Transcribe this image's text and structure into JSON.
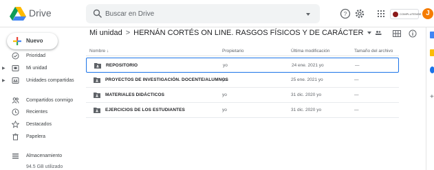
{
  "app": {
    "title": "Drive"
  },
  "search": {
    "placeholder": "Buscar en Drive",
    "value": ""
  },
  "header": {
    "avatar_initial": "J",
    "org_badge_text": "COMPLUTENSE"
  },
  "sidebar": {
    "new_label": "Nuevo",
    "items": [
      {
        "label": "Prioridad",
        "icon": "priority-check-icon",
        "expandable": false
      },
      {
        "label": "Mi unidad",
        "icon": "my-drive-icon",
        "expandable": true
      },
      {
        "label": "Unidades compartidas",
        "icon": "shared-drives-icon",
        "expandable": true
      },
      {
        "label": "Compartidos conmigo",
        "icon": "shared-with-me-icon",
        "expandable": false
      },
      {
        "label": "Recientes",
        "icon": "clock-icon",
        "expandable": false
      },
      {
        "label": "Destacados",
        "icon": "star-icon",
        "expandable": false
      },
      {
        "label": "Papelera",
        "icon": "trash-icon",
        "expandable": false
      }
    ],
    "storage": {
      "label": "Almacenamiento",
      "used": "94.5 GB utilizado"
    }
  },
  "breadcrumb": {
    "root": "Mi unidad",
    "separator": ">",
    "current": "HERNÁN CORTÉS ON LINE. RASGOS FÍSICOS Y DE CARÁCTER"
  },
  "table": {
    "columns": {
      "name": "Nombre",
      "sort_arrow": "↓",
      "owner": "Propietario",
      "modified": "Última modificación",
      "size": "Tamaño del archivo"
    },
    "rows": [
      {
        "name": "REPOSITORIO",
        "owner": "yo",
        "modified": "24 ene. 2021 yo",
        "size": "—",
        "selected": true
      },
      {
        "name": "PROYECTOS DE INVESTIGACIÓN. DOCENTE/ALUMNOS",
        "owner": "yo",
        "modified": "25 ene. 2021 yo",
        "size": "—",
        "selected": false
      },
      {
        "name": "MATERIALES DIDÁCTICOS",
        "owner": "yo",
        "modified": "31 dic. 2020 yo",
        "size": "—",
        "selected": false
      },
      {
        "name": "EJERCICIOS DE LOS ESTUDIANTES",
        "owner": "yo",
        "modified": "31 dic. 2020 yo",
        "size": "—",
        "selected": false
      }
    ]
  },
  "colors": {
    "accent": "#1a73e8",
    "avatar": "#f57c00",
    "folder": "#5f6368",
    "selected_border": "#1a73e8"
  }
}
